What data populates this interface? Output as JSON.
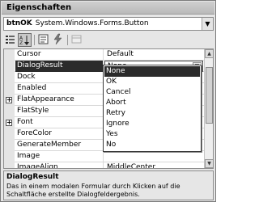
{
  "window": {
    "title": "Eigenschaften"
  },
  "object_selector": {
    "name": "btnOK",
    "type": "System.Windows.Forms.Button"
  },
  "toolbar": {
    "buttons": [
      {
        "icon": "categorized-icon",
        "active": false
      },
      {
        "icon": "alphabetical-icon",
        "active": true
      },
      {
        "icon": "properties-icon",
        "active": false
      },
      {
        "icon": "events-icon",
        "active": false
      },
      {
        "icon": "property-pages-icon",
        "active": false,
        "disabled": true
      }
    ]
  },
  "properties": [
    {
      "name": "Cursor",
      "value": "Default"
    },
    {
      "name": "DialogResult",
      "value": "None",
      "selected": true
    },
    {
      "name": "Dock",
      "value": ""
    },
    {
      "name": "Enabled",
      "value": ""
    },
    {
      "name": "FlatAppearance",
      "value": "",
      "expandable": true
    },
    {
      "name": "FlatStyle",
      "value": ""
    },
    {
      "name": "Font",
      "value": "",
      "expandable": true
    },
    {
      "name": "ForeColor",
      "value": ""
    },
    {
      "name": "GenerateMember",
      "value": ""
    },
    {
      "name": "Image",
      "value": ""
    },
    {
      "name": "ImageAlign",
      "value": "MiddleCenter"
    }
  ],
  "dropdown": {
    "options": [
      "None",
      "OK",
      "Cancel",
      "Abort",
      "Retry",
      "Ignore",
      "Yes",
      "No"
    ],
    "highlighted": "None"
  },
  "description": {
    "title": "DialogResult",
    "text": "Das in einem modalen Formular durch Klicken auf die Schaltfläche erstellte Dialogfeldergebnis."
  },
  "colors": {
    "selection": "#2b2b2b",
    "window_bg": "#e6e6e6"
  }
}
